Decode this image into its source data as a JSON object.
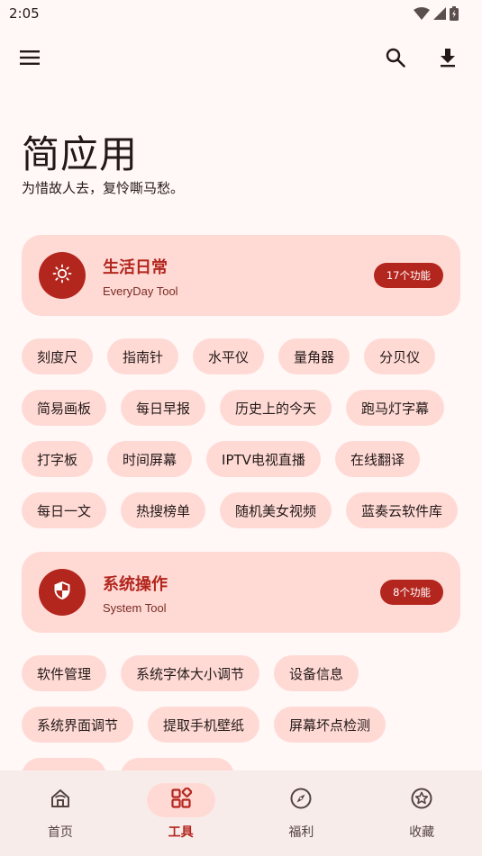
{
  "status": {
    "time": "2:05"
  },
  "header": {
    "title": "简应用",
    "subtitle": "为惜故人去，复怜嘶马愁。"
  },
  "sections": [
    {
      "title": "生活日常",
      "subtitle": "EveryDay Tool",
      "badge": "17个功能",
      "icon": "sun-icon",
      "chip_rows": [
        [
          "刻度尺",
          "指南针",
          "水平仪",
          "量角器",
          "分贝仪"
        ],
        [
          "简易画板",
          "每日早报",
          "历史上的今天",
          "跑马灯字幕"
        ],
        [
          "打字板",
          "时间屏幕",
          "IPTV电视直播",
          "在线翻译"
        ],
        [
          "每日一文",
          "热搜榜单",
          "随机美女视频",
          "蓝奏云软件库"
        ]
      ]
    },
    {
      "title": "系统操作",
      "subtitle": "System Tool",
      "badge": "8个功能",
      "icon": "shield-icon",
      "chip_rows": [
        [
          "软件管理",
          "系统字体大小调节",
          "设备信息"
        ],
        [
          "系统界面调节",
          "提取手机壁纸",
          "屏幕坏点检测"
        ]
      ]
    }
  ],
  "bottom_nav": [
    {
      "label": "首页",
      "icon": "home-icon"
    },
    {
      "label": "工具",
      "icon": "grid-icon",
      "active": true
    },
    {
      "label": "福利",
      "icon": "compass-icon"
    },
    {
      "label": "收藏",
      "icon": "star-icon"
    }
  ],
  "colors": {
    "accent": "#B3261E",
    "container": "#FFDAD5",
    "background": "#FFF8F6"
  }
}
